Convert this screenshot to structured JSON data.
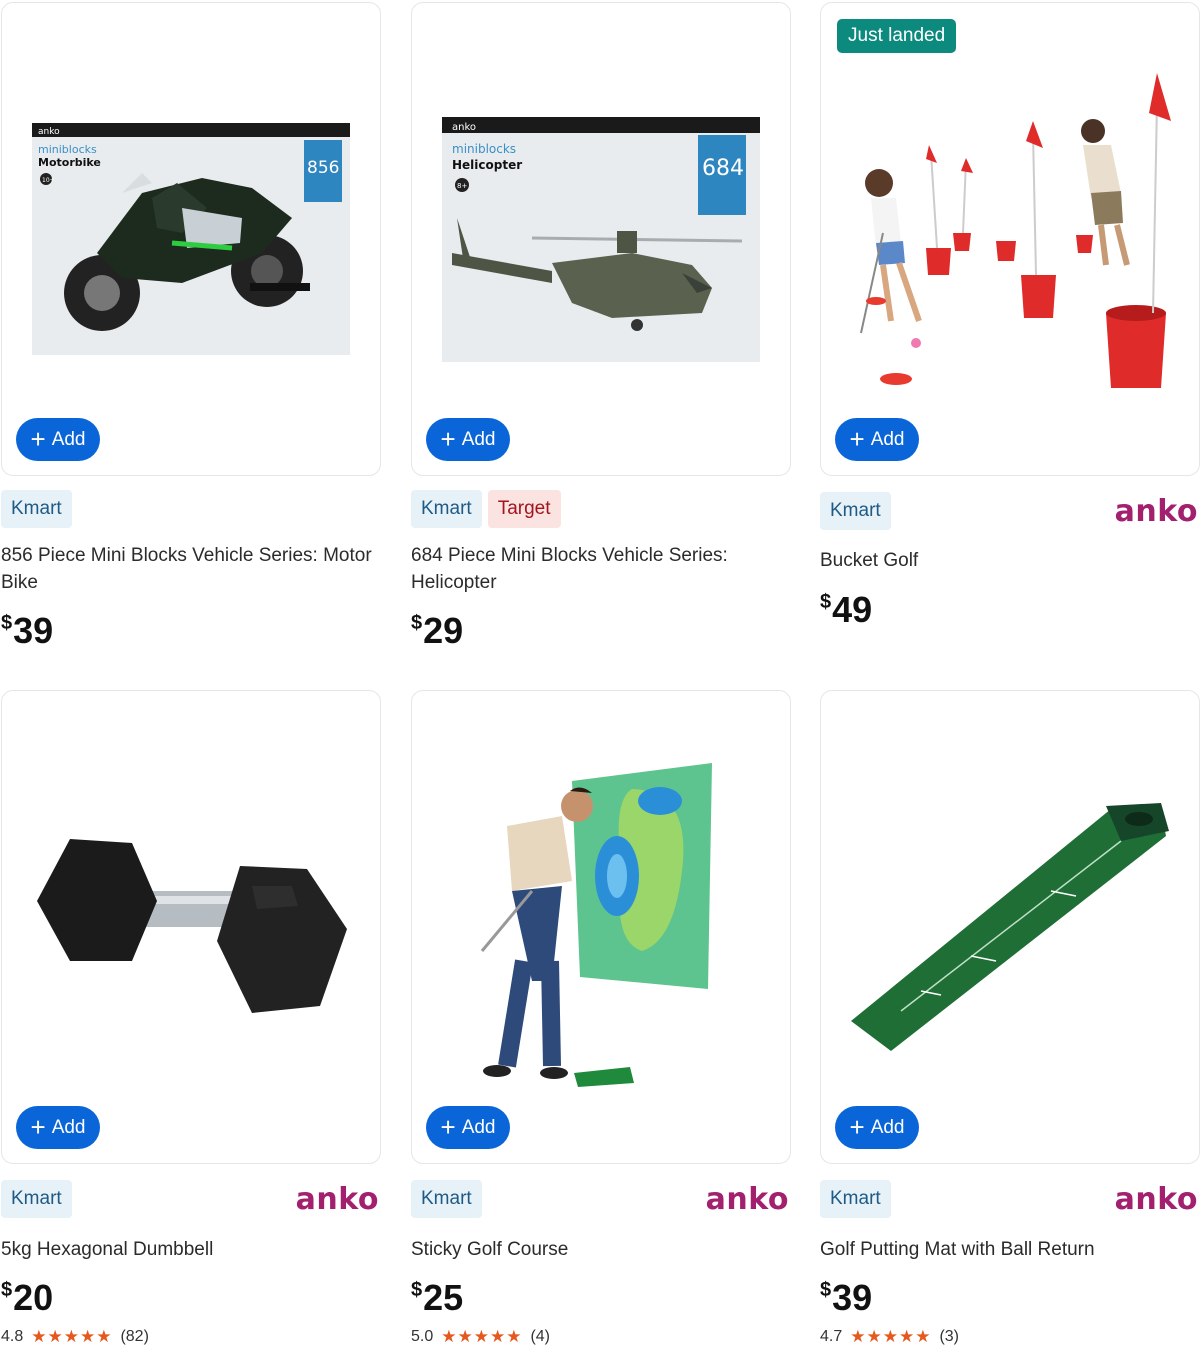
{
  "add_label": "Add",
  "products": [
    {
      "badge": "",
      "stores": [
        "Kmart"
      ],
      "brand": "",
      "title": "856 Piece Mini Blocks Vehicle Series: Motor Bike",
      "currency": "$",
      "price": "39",
      "rating": "",
      "stars": "",
      "reviews": "",
      "box_brand": "anko",
      "box_series": "miniblocks",
      "box_name": "Motorbike",
      "box_pieces": "856",
      "box_age": "10+"
    },
    {
      "badge": "",
      "stores": [
        "Kmart",
        "Target"
      ],
      "brand": "",
      "title": "684 Piece Mini Blocks Vehicle Series: Helicopter",
      "currency": "$",
      "price": "29",
      "rating": "",
      "stars": "",
      "reviews": "",
      "box_brand": "anko",
      "box_series": "miniblocks",
      "box_name": "Helicopter",
      "box_pieces": "684",
      "box_age": "8+"
    },
    {
      "badge": "Just landed",
      "stores": [
        "Kmart"
      ],
      "brand": "anko",
      "title": "Bucket Golf",
      "currency": "$",
      "price": "49",
      "rating": "",
      "stars": "",
      "reviews": ""
    },
    {
      "badge": "",
      "stores": [
        "Kmart"
      ],
      "brand": "anko",
      "title": "5kg Hexagonal Dumbbell",
      "currency": "$",
      "price": "20",
      "rating": "4.8",
      "stars": "★★★★★",
      "reviews": "(82)"
    },
    {
      "badge": "",
      "stores": [
        "Kmart"
      ],
      "brand": "anko",
      "title": "Sticky Golf Course",
      "currency": "$",
      "price": "25",
      "rating": "5.0",
      "stars": "★★★★★",
      "reviews": "(4)"
    },
    {
      "badge": "",
      "stores": [
        "Kmart"
      ],
      "brand": "anko",
      "title": "Golf Putting Mat with Ball Return",
      "currency": "$",
      "price": "39",
      "rating": "4.7",
      "stars": "★★★★★",
      "reviews": "(3)"
    }
  ],
  "colors": {
    "add_button": "#0a66d8",
    "badge_new": "#0c8a7e",
    "brand_anko": "#a3206f",
    "kmart_tag_bg": "#e7f1f8",
    "target_tag_bg": "#fbe3e2",
    "stars": "#e5581e"
  }
}
